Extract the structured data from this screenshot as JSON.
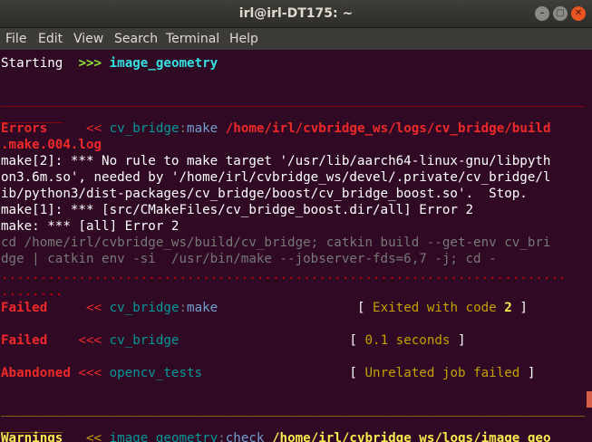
{
  "window": {
    "title": "irl@irl-DT175: ~"
  },
  "menu": [
    "File",
    "Edit",
    "View",
    "Search",
    "Terminal",
    "Help"
  ],
  "terminal": {
    "starting": {
      "label": "Starting",
      "arrows": ">>>",
      "pkg": "image_geometry"
    },
    "sep_red": "______________________________________________________________________________________",
    "sep_red_tail": "________",
    "errors": {
      "label": "Errors",
      "arrows": "<<",
      "pkg": "cv_bridge",
      "colon": ":",
      "verb": "make",
      "path1": "/home/irl/cvbridge_ws/logs/cv_bridge/build",
      "path2": ".make.004.log"
    },
    "make_lines": [
      "make[2]: *** No rule to make target '/usr/lib/aarch64-linux-gnu/libpyth",
      "on3.6m.so', needed by '/home/irl/cvbridge_ws/devel/.private/cv_bridge/l",
      "ib/python3/dist-packages/cv_bridge/boost/cv_bridge_boost.so'.  Stop.",
      "make[1]: *** [src/CMakeFiles/cv_bridge_boost.dir/all] Error 2",
      "make: *** [all] Error 2"
    ],
    "cd_lines": [
      "cd /home/irl/cvbridge_ws/build/cv_bridge; catkin build --get-env cv_bri",
      "dge | catkin env -si  /usr/bin/make --jobserver-fds=6,7 -j; cd -"
    ],
    "dots1": ".........................................................................",
    "dots2": "........",
    "failed1": {
      "label": "Failed",
      "arrows": "<<",
      "pkg": "cv_bridge",
      "colon": ":",
      "verb": "make",
      "status_pre": "Exited with code",
      "code": "2"
    },
    "failed2": {
      "label": "Failed",
      "arrows": "<<<",
      "pkg": "cv_bridge",
      "status": "0.1 seconds"
    },
    "abandoned": {
      "label": "Abandoned",
      "arrows": "<<<",
      "pkg": "opencv_tests",
      "status": "Unrelated job failed"
    },
    "sep_yellow": "______________________________________________________________________________________",
    "sep_yellow_tail": "________",
    "warnings": {
      "label": "Warnings",
      "arrows": "<<",
      "pkg": "image_geometry",
      "colon": ":",
      "verb": "check",
      "path": "/home/irl/cvbridge_ws/logs/image_geo"
    }
  }
}
